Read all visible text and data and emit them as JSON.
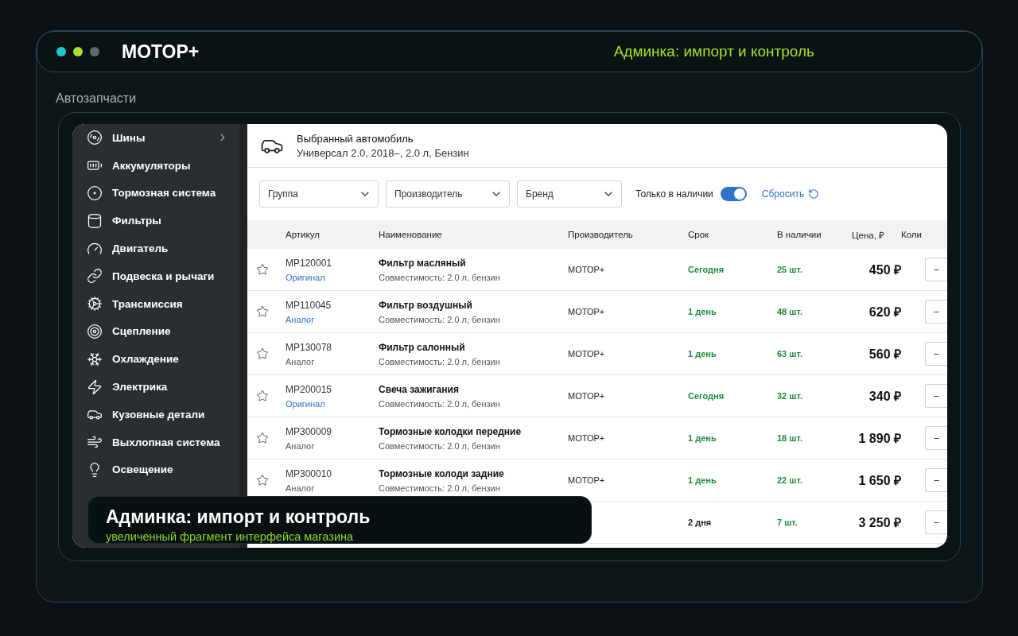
{
  "header": {
    "brand": "МОТОР+",
    "tagline": "Админка: импорт и контроль"
  },
  "section_label": "Автозапчасти",
  "sidebar": {
    "items": [
      {
        "label": "Шины",
        "submenu": true
      },
      {
        "label": "Аккумуляторы",
        "submenu": false
      },
      {
        "label": "Тормозная система",
        "submenu": false
      },
      {
        "label": "Фильтры",
        "submenu": false
      },
      {
        "label": "Двигатель",
        "submenu": false
      },
      {
        "label": "Подвеска и рычаги",
        "submenu": false
      },
      {
        "label": "Трансмиссия",
        "submenu": false
      },
      {
        "label": "Сцепление",
        "submenu": false
      },
      {
        "label": "Охлаждение",
        "submenu": false
      },
      {
        "label": "Электрика",
        "submenu": false
      },
      {
        "label": "Кузовные детали",
        "submenu": false
      },
      {
        "label": "Выхлопная система",
        "submenu": false
      },
      {
        "label": "Освещение",
        "submenu": false
      }
    ]
  },
  "vehicle": {
    "title": "Выбранный автомобиль",
    "description": "Универсал 2.0, 2018–, 2.0 л, Бензин"
  },
  "filters": {
    "dropdowns": [
      "Группа",
      "Производитель",
      "Бренд"
    ],
    "in_stock_toggle": {
      "label": "Только в наличии",
      "on": true
    },
    "reset": "Сбросить"
  },
  "table": {
    "columns": [
      "Артикул",
      "Наименование",
      "Производитель",
      "Срок",
      "В наличии",
      "Цена, ₽",
      "Коли"
    ],
    "rows": [
      {
        "favorite": false,
        "article": "MP120001",
        "type": {
          "label": "Оригинал",
          "kind": "link"
        },
        "name": "Фильтр масляный",
        "compat": "Совместимость: 2.0 л, бензин",
        "maker": "МОТОР+",
        "term": "Сегодня",
        "color": "#1e8a3c",
        "stock": "25 шт.",
        "price": "450 ₽",
        "qty_minus": "−"
      },
      {
        "favorite": false,
        "article": "MP110045",
        "type": {
          "label": "Аналог",
          "kind": "link"
        },
        "name": "Фильтр воздушный",
        "compat": "Совместимость: 2.0 л, бензин",
        "maker": "МОТОР+",
        "term": "1 день",
        "color": "#1e8a3c",
        "stock": "48 шт.",
        "price": "620 ₽",
        "qty_minus": "−"
      },
      {
        "favorite": false,
        "article": "MP130078",
        "type": {
          "label": "Аналог",
          "kind": "plain"
        },
        "name": "Фильтр салонный",
        "compat": "Совместимость: 2.0 л, бензин",
        "maker": "МОТОР+",
        "term": "1 день",
        "color": "#1e8a3c",
        "stock": "63 шт.",
        "price": "560 ₽",
        "qty_minus": "−"
      },
      {
        "favorite": false,
        "article": "MP200015",
        "type": {
          "label": "Оригинал",
          "kind": "link"
        },
        "name": "Свеча зажигания",
        "compat": "Совместимость: 2.0 л, бензин",
        "maker": "МОТОР+",
        "term": "Сегодня",
        "color": "#1e8a3c",
        "stock": "32 шт.",
        "price": "340 ₽",
        "qty_minus": "−"
      },
      {
        "favorite": false,
        "article": "MP300009",
        "type": {
          "label": "Аналог",
          "kind": "plain"
        },
        "name": "Тормозные колодки передние",
        "compat": "Совместимость: 2.0 л, бензин",
        "maker": "МОТОР+",
        "term": "1 день",
        "color": "#1e8a3c",
        "stock": "18 шт.",
        "price": "1 890 ₽",
        "qty_minus": "−"
      },
      {
        "favorite": false,
        "article": "MP300010",
        "type": {
          "label": "Аналог",
          "kind": "plain"
        },
        "name": "Тормозные колоди задние",
        "compat": "Совместимость: 2.0 л, бензин",
        "maker": "МОТОР+",
        "term": "1 день",
        "color": "#1e8a3c",
        "stock": "22 шт.",
        "price": "1 650 ₽",
        "qty_minus": "−"
      },
      {
        "term": "2 дня",
        "color": "#222222",
        "stock": "7 шт.",
        "price": "3 250 ₽",
        "qty_minus": "−"
      }
    ]
  },
  "caption": {
    "title": "Админка: импорт и контроль",
    "subtitle": "увеличенный фрагмент интерфейса магазина"
  }
}
